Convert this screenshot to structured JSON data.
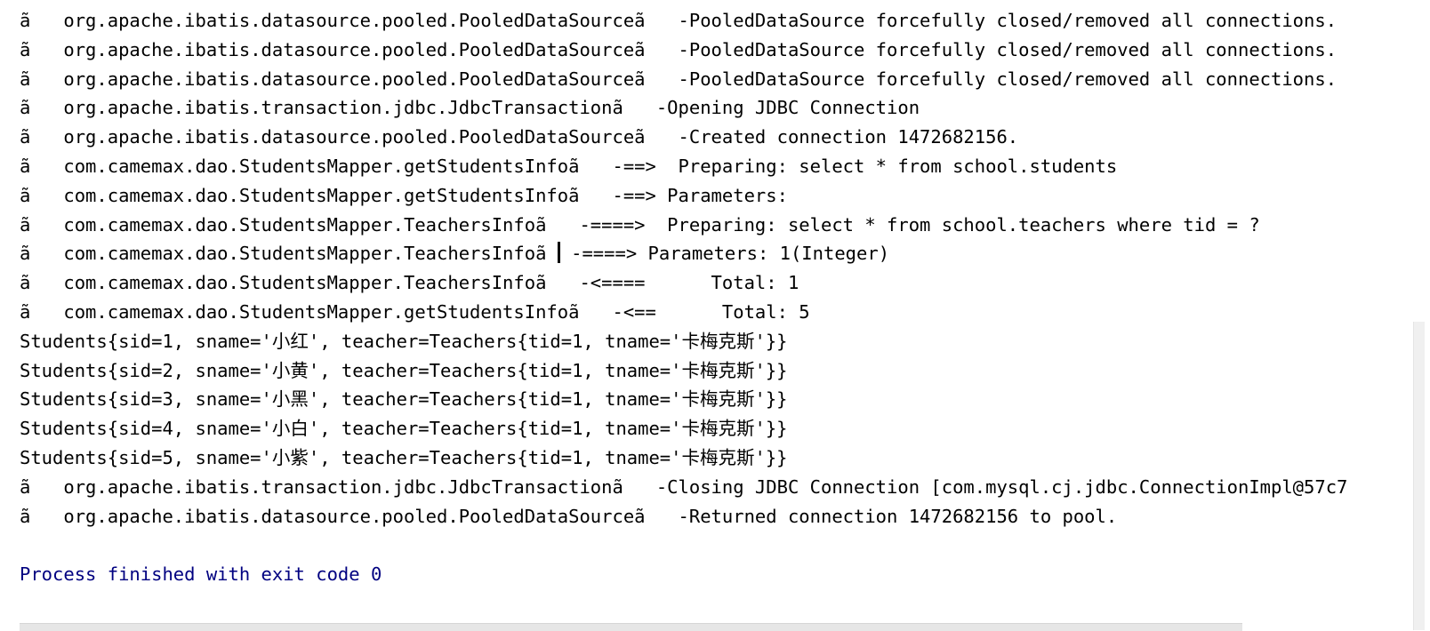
{
  "console": {
    "lines": [
      {
        "prefix": "ã",
        "text": "org.apache.ibatis.datasource.pooled.PooledDataSourceã   -PooledDataSource forcefully closed/removed all connections."
      },
      {
        "prefix": "ã",
        "text": "org.apache.ibatis.datasource.pooled.PooledDataSourceã   -PooledDataSource forcefully closed/removed all connections."
      },
      {
        "prefix": "ã",
        "text": "org.apache.ibatis.datasource.pooled.PooledDataSourceã   -PooledDataSource forcefully closed/removed all connections."
      },
      {
        "prefix": "ã",
        "text": "org.apache.ibatis.transaction.jdbc.JdbcTransactionã   -Opening JDBC Connection"
      },
      {
        "prefix": "ã",
        "text": "org.apache.ibatis.datasource.pooled.PooledDataSourceã   -Created connection 1472682156."
      },
      {
        "prefix": "ã",
        "text": "com.camemax.dao.StudentsMapper.getStudentsInfoã   -==>  Preparing: select * from school.students"
      },
      {
        "prefix": "ã",
        "text": "com.camemax.dao.StudentsMapper.getStudentsInfoã   -==> Parameters: "
      },
      {
        "prefix": "ã",
        "text": "com.camemax.dao.StudentsMapper.TeachersInfoã   -====>  Preparing: select * from school.teachers where tid = ?"
      },
      {
        "prefix": "ã",
        "text_before_caret": "com.camemax.dao.StudentsMapper.TeachersInfoã ",
        "text_after_caret": " -====> Parameters: 1(Integer)"
      },
      {
        "prefix": "ã",
        "text": "com.camemax.dao.StudentsMapper.TeachersInfoã   -<====      Total: 1"
      },
      {
        "prefix": "ã",
        "text": "com.camemax.dao.StudentsMapper.getStudentsInfoã   -<==      Total: 5"
      },
      {
        "text": "Students{sid=1, sname='小红', teacher=Teachers{tid=1, tname='卡梅克斯'}}"
      },
      {
        "text": "Students{sid=2, sname='小黄', teacher=Teachers{tid=1, tname='卡梅克斯'}}"
      },
      {
        "text": "Students{sid=3, sname='小黑', teacher=Teachers{tid=1, tname='卡梅克斯'}}"
      },
      {
        "text": "Students{sid=4, sname='小白', teacher=Teachers{tid=1, tname='卡梅克斯'}}"
      },
      {
        "text": "Students{sid=5, sname='小紫', teacher=Teachers{tid=1, tname='卡梅克斯'}}"
      },
      {
        "prefix": "ã",
        "text": "org.apache.ibatis.transaction.jdbc.JdbcTransactionã   -Closing JDBC Connection [com.mysql.cj.jdbc.ConnectionImpl@57c7"
      },
      {
        "prefix": "ã",
        "text": "org.apache.ibatis.datasource.pooled.PooledDataSourceã   -Returned connection 1472682156 to pool."
      },
      {
        "text": ""
      },
      {
        "text": "Process finished with exit code 0"
      }
    ],
    "colors": {
      "text": "#000000",
      "exit_message": "#000080",
      "background": "#ffffff"
    }
  }
}
